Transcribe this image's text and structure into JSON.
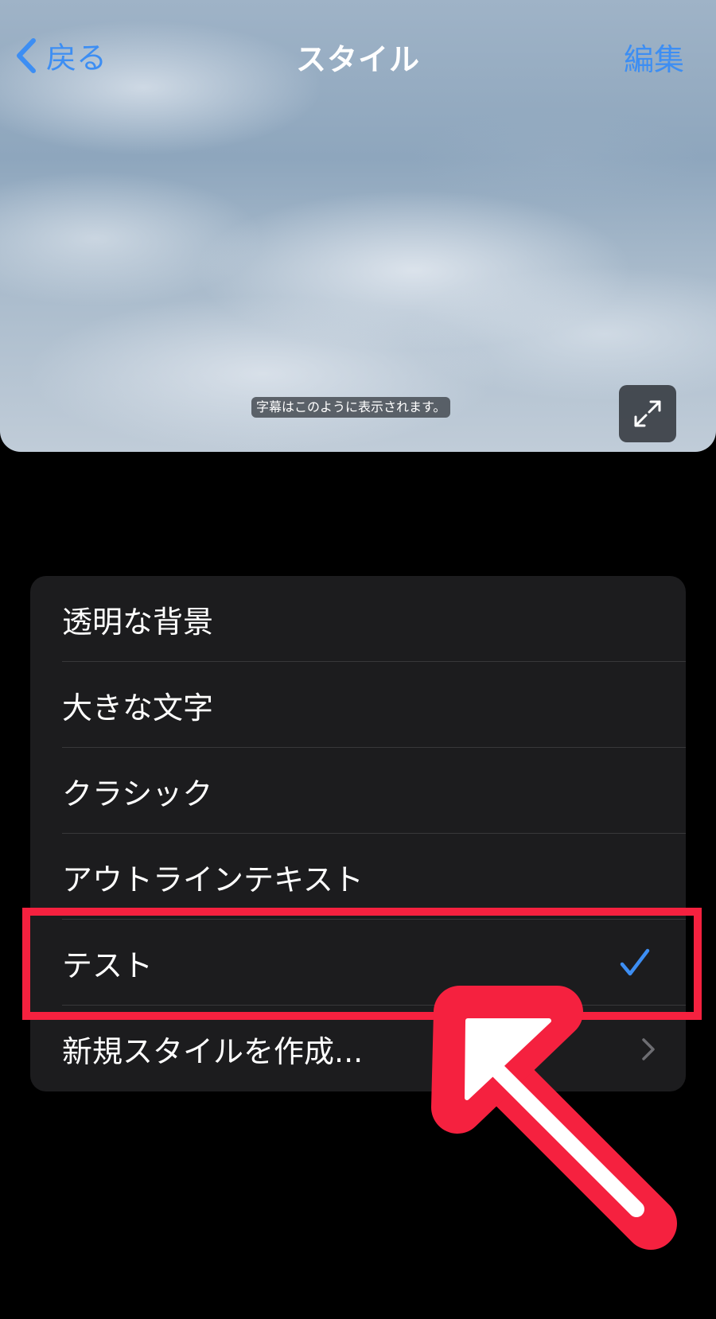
{
  "nav": {
    "back_label": "戻る",
    "title": "スタイル",
    "edit_label": "編集"
  },
  "preview": {
    "caption_text": "字幕はこのように表示されます。",
    "expand_icon": "expand-arrows-icon"
  },
  "styles": {
    "items": [
      {
        "label": "透明な背景",
        "selected": false
      },
      {
        "label": "大きな文字",
        "selected": false
      },
      {
        "label": "クラシック",
        "selected": false
      },
      {
        "label": "アウトラインテキスト",
        "selected": false
      },
      {
        "label": "テスト",
        "selected": true
      },
      {
        "label": "新規スタイルを作成..."
      }
    ]
  },
  "colors": {
    "accent": "#3d8ef3",
    "annotation": "#f5213f",
    "list_background": "#1c1c1e"
  }
}
